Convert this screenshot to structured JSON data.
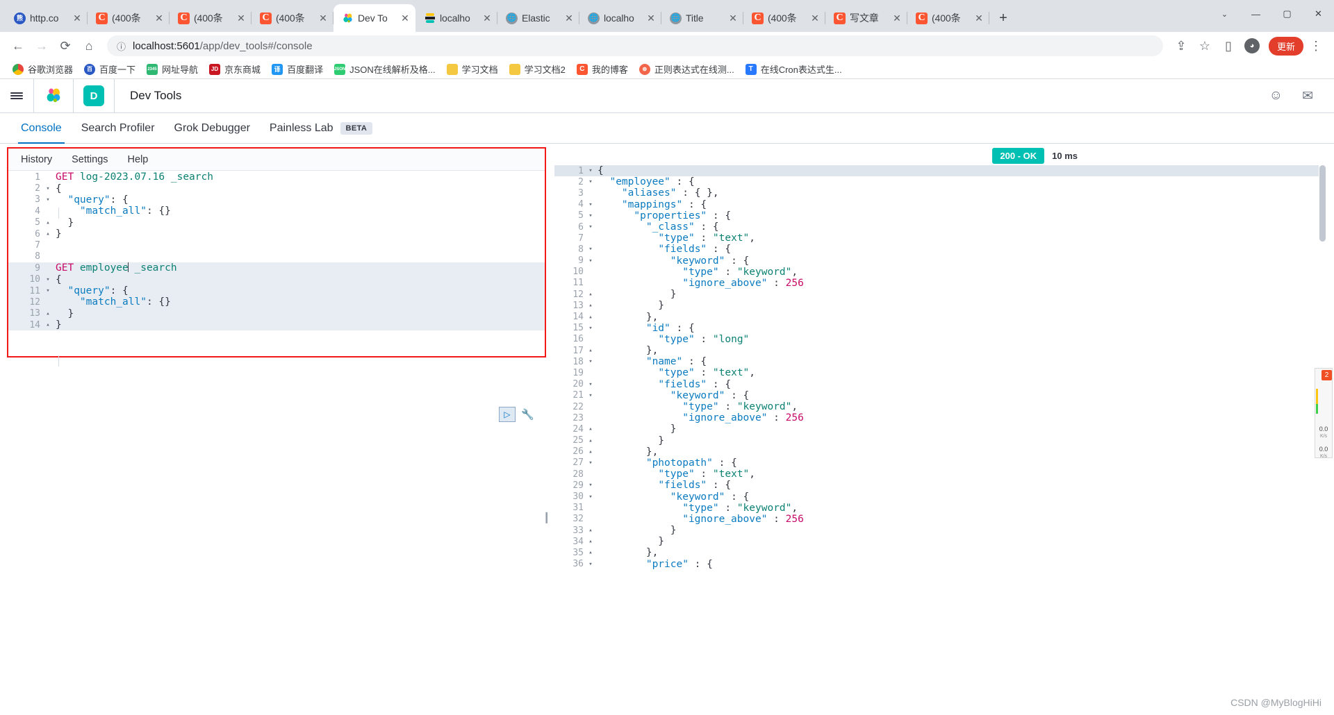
{
  "browser": {
    "tabs": [
      {
        "label": "http.co",
        "icon": "baidu-icon",
        "active": false
      },
      {
        "label": "(400条",
        "icon": "csdn-icon",
        "active": false
      },
      {
        "label": "(400条",
        "icon": "csdn-icon",
        "active": false
      },
      {
        "label": "(400条",
        "icon": "csdn-icon",
        "active": false
      },
      {
        "label": "Dev To",
        "icon": "kibana-icon",
        "active": true
      },
      {
        "label": "localho",
        "icon": "elastic-icon",
        "active": false
      },
      {
        "label": "Elastic",
        "icon": "globe-icon",
        "active": false
      },
      {
        "label": "localho",
        "icon": "globe-icon",
        "active": false
      },
      {
        "label": "Title",
        "icon": "globe-icon",
        "active": false
      },
      {
        "label": "(400条",
        "icon": "csdn-icon",
        "active": false
      },
      {
        "label": "写文章",
        "icon": "csdn-icon",
        "active": false
      },
      {
        "label": "(400条",
        "icon": "csdn-icon",
        "active": false
      }
    ],
    "new_tab_label": "+",
    "close_label": "✕",
    "window_controls": {
      "chevron": "⌄",
      "minimize": "—",
      "maximize": "▢",
      "close": "✕"
    },
    "toolbar": {
      "back": "←",
      "forward": "→",
      "reload": "⟳",
      "home": "⌂",
      "site_info_icon": "info-icon",
      "url_host": "localhost:5601",
      "url_path": "/app/dev_tools#/console",
      "share_icon": "⇪",
      "bookmark_icon": "☆",
      "sidepanel_icon": "▯",
      "profile_icon": "person-icon",
      "update_label": "更新",
      "menu_icon": "⋮"
    },
    "bookmarks": [
      {
        "label": "谷歌浏览器",
        "icon": "chrome-icon",
        "color": "#e8453c"
      },
      {
        "label": "百度一下",
        "icon": "baidu-icon",
        "color": "#2b59c3"
      },
      {
        "label": "网址导航",
        "icon": "hao123-icon",
        "color": "#2eb872"
      },
      {
        "label": "京东商城",
        "icon": "jd-icon",
        "color": "#c81623"
      },
      {
        "label": "百度翻译",
        "icon": "fanyi-icon",
        "color": "#2196f3"
      },
      {
        "label": "JSON在线解析及格...",
        "icon": "json-icon",
        "color": "#2ecc71"
      },
      {
        "label": "学习文档",
        "icon": "folder-icon",
        "color": "#f5c842"
      },
      {
        "label": "学习文档2",
        "icon": "folder-icon",
        "color": "#f5c842"
      },
      {
        "label": "我的博客",
        "icon": "csdn-icon",
        "color": "#fc5531"
      },
      {
        "label": "正则表达式在线测...",
        "icon": "regex-icon",
        "color": "#f4664a"
      },
      {
        "label": "在线Cron表达式生...",
        "icon": "cron-icon",
        "color": "#2979ff"
      }
    ]
  },
  "kibana": {
    "menu_icon": "hamburger-icon",
    "logo_icon": "elastic-logo-icon",
    "app_badge": "D",
    "app_title": "Dev Tools",
    "header_icons": [
      {
        "name": "help-icon",
        "glyph": "☺"
      },
      {
        "name": "mail-icon",
        "glyph": "✉"
      }
    ],
    "tabs": [
      {
        "label": "Console",
        "active": true,
        "badge": null
      },
      {
        "label": "Search Profiler",
        "active": false,
        "badge": null
      },
      {
        "label": "Grok Debugger",
        "active": false,
        "badge": null
      },
      {
        "label": "Painless Lab",
        "active": false,
        "badge": "BETA"
      }
    ],
    "accent_color": "#0071c2",
    "teal_color": "#00bfb3"
  },
  "console": {
    "menubar": [
      "History",
      "Settings",
      "Help"
    ],
    "request_lines": [
      {
        "n": 1,
        "fold": "",
        "segments": [
          {
            "t": "GET ",
            "c": "k-method"
          },
          {
            "t": "log-2023.07.16 _search",
            "c": "k-url"
          }
        ]
      },
      {
        "n": 2,
        "fold": "▾",
        "segments": [
          {
            "t": "{",
            "c": "k-punc"
          }
        ]
      },
      {
        "n": 3,
        "fold": "▾",
        "segments": [
          {
            "t": "  ",
            "c": "k-punc"
          },
          {
            "t": "\"query\"",
            "c": "k-key"
          },
          {
            "t": ": {",
            "c": "k-punc"
          }
        ]
      },
      {
        "n": 4,
        "fold": "",
        "segments": [
          {
            "t": "    ",
            "c": "k-punc"
          },
          {
            "t": "\"match_all\"",
            "c": "k-key"
          },
          {
            "t": ": {}",
            "c": "k-punc"
          }
        ]
      },
      {
        "n": 5,
        "fold": "▴",
        "segments": [
          {
            "t": "  }",
            "c": "k-punc"
          }
        ]
      },
      {
        "n": 6,
        "fold": "▴",
        "segments": [
          {
            "t": "}",
            "c": "k-punc"
          }
        ]
      },
      {
        "n": 7,
        "fold": "",
        "segments": []
      },
      {
        "n": 8,
        "fold": "",
        "segments": []
      },
      {
        "n": 9,
        "fold": "",
        "segments": [
          {
            "t": "GET ",
            "c": "k-method"
          },
          {
            "t": "employee",
            "c": "k-url"
          },
          {
            "t": "|",
            "c": "caret"
          },
          {
            "t": " _search",
            "c": "k-url"
          }
        ]
      },
      {
        "n": 10,
        "fold": "▾",
        "segments": [
          {
            "t": "{",
            "c": "k-punc"
          }
        ]
      },
      {
        "n": 11,
        "fold": "▾",
        "segments": [
          {
            "t": "  ",
            "c": "k-punc"
          },
          {
            "t": "\"query\"",
            "c": "k-key"
          },
          {
            "t": ": {",
            "c": "k-punc"
          }
        ]
      },
      {
        "n": 12,
        "fold": "",
        "segments": [
          {
            "t": "    ",
            "c": "k-punc"
          },
          {
            "t": "\"match_all\"",
            "c": "k-key"
          },
          {
            "t": ": {}",
            "c": "k-punc"
          }
        ]
      },
      {
        "n": 13,
        "fold": "▴",
        "segments": [
          {
            "t": "  }",
            "c": "k-punc"
          }
        ]
      },
      {
        "n": 14,
        "fold": "▴",
        "segments": [
          {
            "t": "}",
            "c": "k-punc"
          }
        ]
      }
    ],
    "run_button_icon": "play-icon",
    "wrench_icon": "wrench-icon",
    "splitter_icon": "vertical-splitter",
    "response": {
      "status_badge": "200 - OK",
      "time_badge": "10 ms",
      "lines": [
        {
          "n": 1,
          "fold": "▾",
          "segments": [
            {
              "t": "{",
              "c": "r-punc"
            }
          ]
        },
        {
          "n": 2,
          "fold": "▾",
          "segments": [
            {
              "t": "  ",
              "c": "r-punc"
            },
            {
              "t": "\"employee\"",
              "c": "r-str"
            },
            {
              "t": " : {",
              "c": "r-punc"
            }
          ]
        },
        {
          "n": 3,
          "fold": "",
          "segments": [
            {
              "t": "    ",
              "c": "r-punc"
            },
            {
              "t": "\"aliases\"",
              "c": "r-str"
            },
            {
              "t": " : { },",
              "c": "r-punc"
            }
          ]
        },
        {
          "n": 4,
          "fold": "▾",
          "segments": [
            {
              "t": "    ",
              "c": "r-punc"
            },
            {
              "t": "\"mappings\"",
              "c": "r-str"
            },
            {
              "t": " : {",
              "c": "r-punc"
            }
          ]
        },
        {
          "n": 5,
          "fold": "▾",
          "segments": [
            {
              "t": "      ",
              "c": "r-punc"
            },
            {
              "t": "\"properties\"",
              "c": "r-str"
            },
            {
              "t": " : {",
              "c": "r-punc"
            }
          ]
        },
        {
          "n": 6,
          "fold": "▾",
          "segments": [
            {
              "t": "        ",
              "c": "r-punc"
            },
            {
              "t": "\"_class\"",
              "c": "r-str"
            },
            {
              "t": " : {",
              "c": "r-punc"
            }
          ]
        },
        {
          "n": 7,
          "fold": "",
          "segments": [
            {
              "t": "          ",
              "c": "r-punc"
            },
            {
              "t": "\"type\"",
              "c": "r-str"
            },
            {
              "t": " : ",
              "c": "r-punc"
            },
            {
              "t": "\"text\"",
              "c": "r-val"
            },
            {
              "t": ",",
              "c": "r-punc"
            }
          ]
        },
        {
          "n": 8,
          "fold": "▾",
          "segments": [
            {
              "t": "          ",
              "c": "r-punc"
            },
            {
              "t": "\"fields\"",
              "c": "r-str"
            },
            {
              "t": " : {",
              "c": "r-punc"
            }
          ]
        },
        {
          "n": 9,
          "fold": "▾",
          "segments": [
            {
              "t": "            ",
              "c": "r-punc"
            },
            {
              "t": "\"keyword\"",
              "c": "r-str"
            },
            {
              "t": " : {",
              "c": "r-punc"
            }
          ]
        },
        {
          "n": 10,
          "fold": "",
          "segments": [
            {
              "t": "              ",
              "c": "r-punc"
            },
            {
              "t": "\"type\"",
              "c": "r-str"
            },
            {
              "t": " : ",
              "c": "r-punc"
            },
            {
              "t": "\"keyword\"",
              "c": "r-val"
            },
            {
              "t": ",",
              "c": "r-punc"
            }
          ]
        },
        {
          "n": 11,
          "fold": "",
          "segments": [
            {
              "t": "              ",
              "c": "r-punc"
            },
            {
              "t": "\"ignore_above\"",
              "c": "r-str"
            },
            {
              "t": " : ",
              "c": "r-punc"
            },
            {
              "t": "256",
              "c": "r-num"
            }
          ]
        },
        {
          "n": 12,
          "fold": "▴",
          "segments": [
            {
              "t": "            }",
              "c": "r-punc"
            }
          ]
        },
        {
          "n": 13,
          "fold": "▴",
          "segments": [
            {
              "t": "          }",
              "c": "r-punc"
            }
          ]
        },
        {
          "n": 14,
          "fold": "▴",
          "segments": [
            {
              "t": "        },",
              "c": "r-punc"
            }
          ]
        },
        {
          "n": 15,
          "fold": "▾",
          "segments": [
            {
              "t": "        ",
              "c": "r-punc"
            },
            {
              "t": "\"id\"",
              "c": "r-str"
            },
            {
              "t": " : {",
              "c": "r-punc"
            }
          ]
        },
        {
          "n": 16,
          "fold": "",
          "segments": [
            {
              "t": "          ",
              "c": "r-punc"
            },
            {
              "t": "\"type\"",
              "c": "r-str"
            },
            {
              "t": " : ",
              "c": "r-punc"
            },
            {
              "t": "\"long\"",
              "c": "r-val"
            }
          ]
        },
        {
          "n": 17,
          "fold": "▴",
          "segments": [
            {
              "t": "        },",
              "c": "r-punc"
            }
          ]
        },
        {
          "n": 18,
          "fold": "▾",
          "segments": [
            {
              "t": "        ",
              "c": "r-punc"
            },
            {
              "t": "\"name\"",
              "c": "r-str"
            },
            {
              "t": " : {",
              "c": "r-punc"
            }
          ]
        },
        {
          "n": 19,
          "fold": "",
          "segments": [
            {
              "t": "          ",
              "c": "r-punc"
            },
            {
              "t": "\"type\"",
              "c": "r-str"
            },
            {
              "t": " : ",
              "c": "r-punc"
            },
            {
              "t": "\"text\"",
              "c": "r-val"
            },
            {
              "t": ",",
              "c": "r-punc"
            }
          ]
        },
        {
          "n": 20,
          "fold": "▾",
          "segments": [
            {
              "t": "          ",
              "c": "r-punc"
            },
            {
              "t": "\"fields\"",
              "c": "r-str"
            },
            {
              "t": " : {",
              "c": "r-punc"
            }
          ]
        },
        {
          "n": 21,
          "fold": "▾",
          "segments": [
            {
              "t": "            ",
              "c": "r-punc"
            },
            {
              "t": "\"keyword\"",
              "c": "r-str"
            },
            {
              "t": " : {",
              "c": "r-punc"
            }
          ]
        },
        {
          "n": 22,
          "fold": "",
          "segments": [
            {
              "t": "              ",
              "c": "r-punc"
            },
            {
              "t": "\"type\"",
              "c": "r-str"
            },
            {
              "t": " : ",
              "c": "r-punc"
            },
            {
              "t": "\"keyword\"",
              "c": "r-val"
            },
            {
              "t": ",",
              "c": "r-punc"
            }
          ]
        },
        {
          "n": 23,
          "fold": "",
          "segments": [
            {
              "t": "              ",
              "c": "r-punc"
            },
            {
              "t": "\"ignore_above\"",
              "c": "r-str"
            },
            {
              "t": " : ",
              "c": "r-punc"
            },
            {
              "t": "256",
              "c": "r-num"
            }
          ]
        },
        {
          "n": 24,
          "fold": "▴",
          "segments": [
            {
              "t": "            }",
              "c": "r-punc"
            }
          ]
        },
        {
          "n": 25,
          "fold": "▴",
          "segments": [
            {
              "t": "          }",
              "c": "r-punc"
            }
          ]
        },
        {
          "n": 26,
          "fold": "▴",
          "segments": [
            {
              "t": "        },",
              "c": "r-punc"
            }
          ]
        },
        {
          "n": 27,
          "fold": "▾",
          "segments": [
            {
              "t": "        ",
              "c": "r-punc"
            },
            {
              "t": "\"photopath\"",
              "c": "r-str"
            },
            {
              "t": " : {",
              "c": "r-punc"
            }
          ]
        },
        {
          "n": 28,
          "fold": "",
          "segments": [
            {
              "t": "          ",
              "c": "r-punc"
            },
            {
              "t": "\"type\"",
              "c": "r-str"
            },
            {
              "t": " : ",
              "c": "r-punc"
            },
            {
              "t": "\"text\"",
              "c": "r-val"
            },
            {
              "t": ",",
              "c": "r-punc"
            }
          ]
        },
        {
          "n": 29,
          "fold": "▾",
          "segments": [
            {
              "t": "          ",
              "c": "r-punc"
            },
            {
              "t": "\"fields\"",
              "c": "r-str"
            },
            {
              "t": " : {",
              "c": "r-punc"
            }
          ]
        },
        {
          "n": 30,
          "fold": "▾",
          "segments": [
            {
              "t": "            ",
              "c": "r-punc"
            },
            {
              "t": "\"keyword\"",
              "c": "r-str"
            },
            {
              "t": " : {",
              "c": "r-punc"
            }
          ]
        },
        {
          "n": 31,
          "fold": "",
          "segments": [
            {
              "t": "              ",
              "c": "r-punc"
            },
            {
              "t": "\"type\"",
              "c": "r-str"
            },
            {
              "t": " : ",
              "c": "r-punc"
            },
            {
              "t": "\"keyword\"",
              "c": "r-val"
            },
            {
              "t": ",",
              "c": "r-punc"
            }
          ]
        },
        {
          "n": 32,
          "fold": "",
          "segments": [
            {
              "t": "              ",
              "c": "r-punc"
            },
            {
              "t": "\"ignore_above\"",
              "c": "r-str"
            },
            {
              "t": " : ",
              "c": "r-punc"
            },
            {
              "t": "256",
              "c": "r-num"
            }
          ]
        },
        {
          "n": 33,
          "fold": "▴",
          "segments": [
            {
              "t": "            }",
              "c": "r-punc"
            }
          ]
        },
        {
          "n": 34,
          "fold": "▴",
          "segments": [
            {
              "t": "          }",
              "c": "r-punc"
            }
          ]
        },
        {
          "n": 35,
          "fold": "▴",
          "segments": [
            {
              "t": "        },",
              "c": "r-punc"
            }
          ]
        },
        {
          "n": 36,
          "fold": "▾",
          "segments": [
            {
              "t": "        ",
              "c": "r-punc"
            },
            {
              "t": "\"price\"",
              "c": "r-str"
            },
            {
              "t": " : {",
              "c": "r-punc"
            }
          ]
        }
      ]
    }
  },
  "perf_widget": {
    "badge": "2",
    "value_top": "0.0",
    "unit_top": "K/s",
    "value_bottom": "0.0",
    "unit_bottom": "K/s"
  },
  "watermark": "CSDN @MyBlogHiHi"
}
